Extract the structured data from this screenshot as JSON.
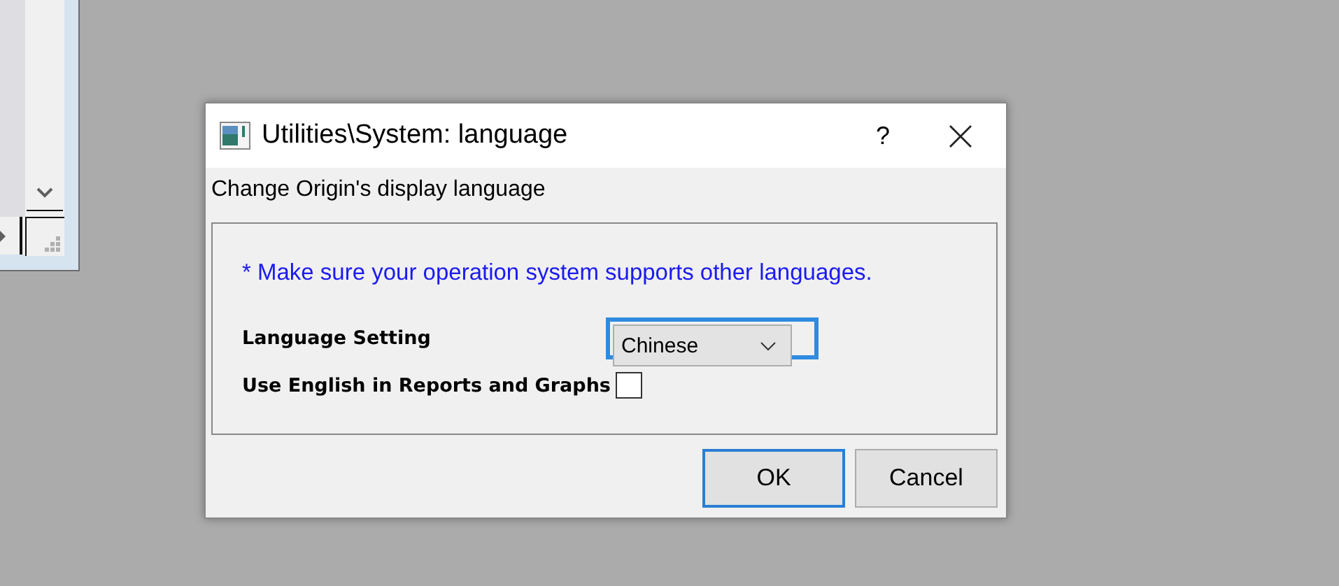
{
  "dialog": {
    "title": "Utilities\\System: language",
    "help": "?",
    "description": "Change Origin's display language",
    "note": "* Make sure your operation system supports other languages.",
    "language": {
      "label": "Language Setting",
      "value": "Chinese",
      "focused": true
    },
    "english_option": {
      "label": "Use English in Reports and Graphs",
      "checked": false
    },
    "buttons": [
      {
        "label": "OK",
        "default": true
      },
      {
        "label": "Cancel",
        "default": false
      }
    ]
  }
}
